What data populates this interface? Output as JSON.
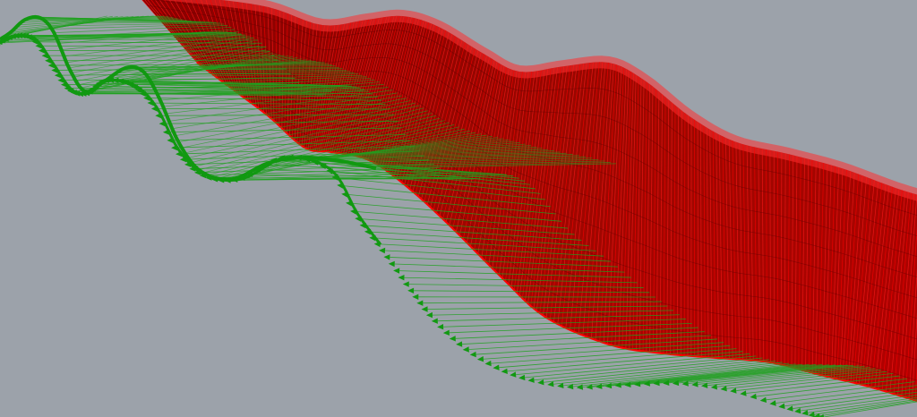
{
  "viewport": {
    "background": "#9ca2aa",
    "surface": {
      "fill_dark": "#7a0000",
      "fill_bright": "#ff0000",
      "line_color": "#ff1a1a",
      "crest_color": "#ff3030"
    },
    "vectors": {
      "color": "#119911",
      "line_color": "#1fa11f"
    }
  }
}
